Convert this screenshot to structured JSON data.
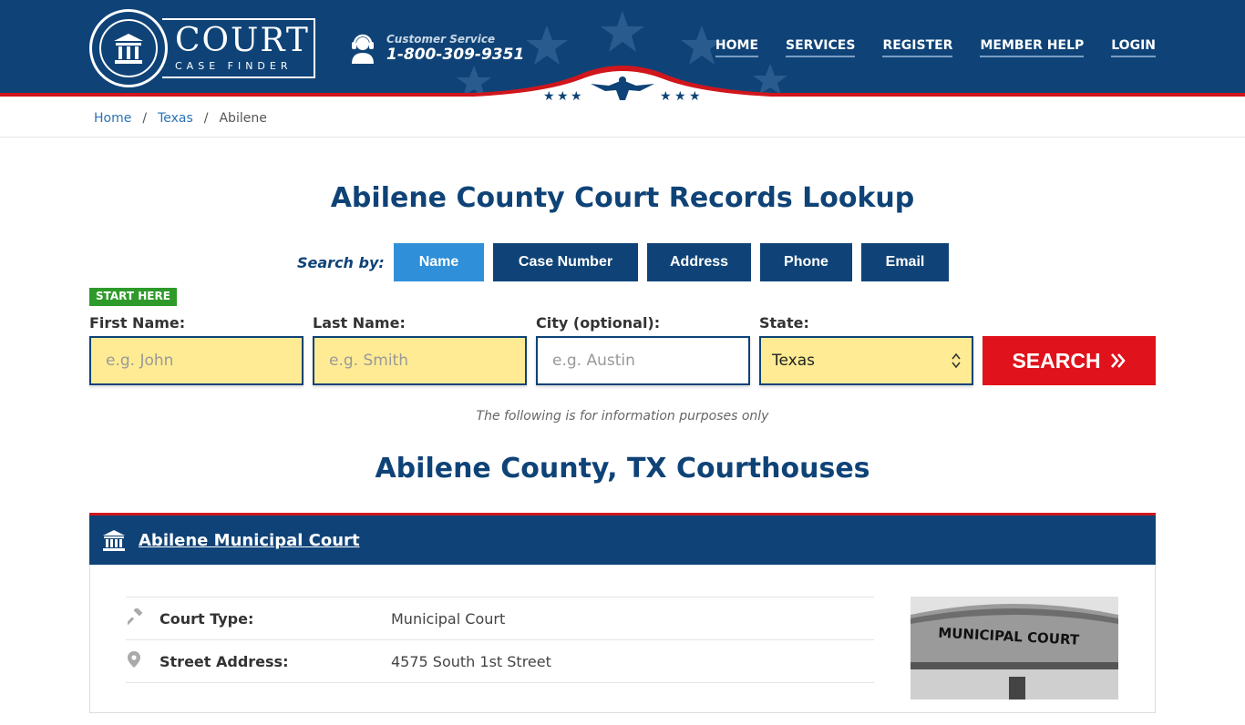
{
  "header": {
    "logo_word": "COURT",
    "logo_sub": "CASE FINDER",
    "customer_service_label": "Customer Service",
    "phone": "1-800-309-9351",
    "nav": [
      "HOME",
      "SERVICES",
      "REGISTER",
      "MEMBER HELP",
      "LOGIN"
    ]
  },
  "breadcrumb": {
    "items": [
      "Home",
      "Texas",
      "Abilene"
    ],
    "separator": "/"
  },
  "title": "Abilene County Court Records Lookup",
  "search_by": {
    "label": "Search by:",
    "tabs": [
      "Name",
      "Case Number",
      "Address",
      "Phone",
      "Email"
    ],
    "active": "Name"
  },
  "form": {
    "start_here": "START HERE",
    "first_name_label": "First Name:",
    "first_name_placeholder": "e.g. John",
    "last_name_label": "Last Name:",
    "last_name_placeholder": "e.g. Smith",
    "city_label": "City (optional):",
    "city_placeholder": "e.g.  Austin",
    "state_label": "State:",
    "state_value": "Texas",
    "search_button": "SEARCH"
  },
  "note": "The following is for information purposes only",
  "courthouses_title": "Abilene County, TX Courthouses",
  "court": {
    "name": "Abilene Municipal Court",
    "rows": [
      {
        "label": "Court Type:",
        "value": "Municipal Court",
        "icon": "gavel-icon"
      },
      {
        "label": "Street Address:",
        "value": "4575 South 1st Street",
        "icon": "map-pin-icon"
      }
    ],
    "photo_caption": "MUNICIPAL COURT"
  },
  "colors": {
    "navy": "#0f4377",
    "red": "#e0121b",
    "active_tab": "#2f8fd8",
    "input_yellow": "#feeb94",
    "green_badge": "#2e9a2a"
  }
}
